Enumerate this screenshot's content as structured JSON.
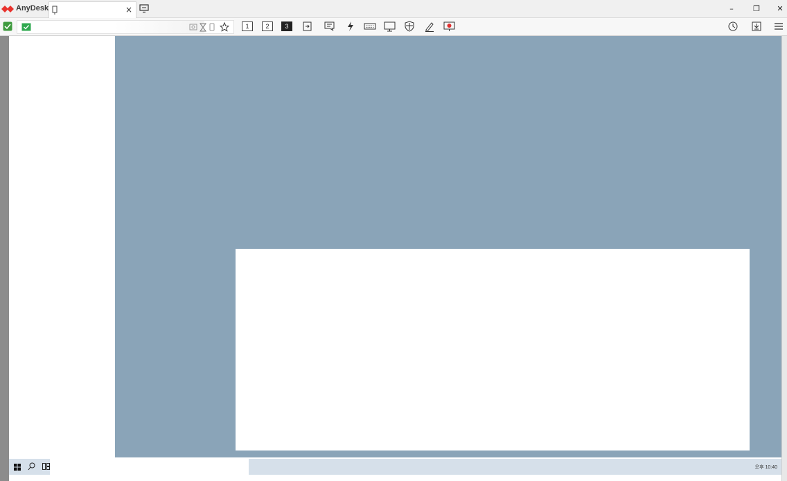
{
  "app": {
    "name": "AnyDesk",
    "brand_color": "#e8322d"
  },
  "tab": {
    "close_label": "×"
  },
  "window_controls": {
    "minimize": "–",
    "restore": "❐",
    "close": "✕"
  },
  "toolbar": {
    "monitors": [
      {
        "label": "1",
        "active": false
      },
      {
        "label": "2",
        "active": false
      },
      {
        "label": "3",
        "active": true
      }
    ],
    "icons": [
      "switch-sides-icon",
      "chat-icon",
      "actions-icon",
      "keyboard-icon",
      "display-icon",
      "permissions-icon",
      "whiteboard-icon",
      "record-icon"
    ],
    "right_icons": [
      "history-icon",
      "download-icon",
      "menu-icon"
    ]
  },
  "remote": {
    "desktop_color": "#8aa4b8",
    "taskbar": {
      "clock": "오후 10:40"
    }
  }
}
